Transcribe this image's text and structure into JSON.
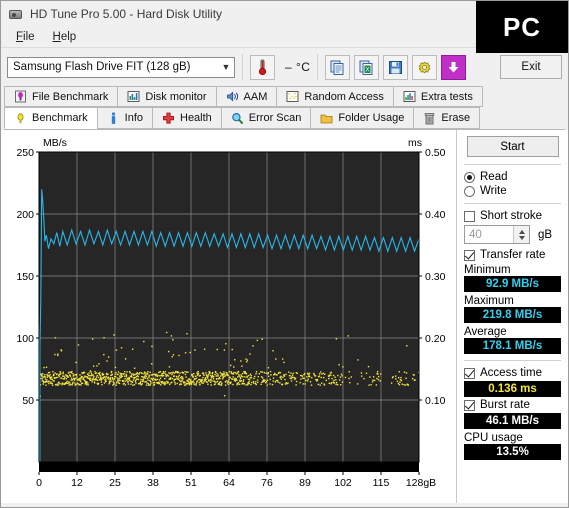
{
  "window": {
    "title": "HD Tune Pro 5.00 - Hard Disk Utility",
    "icon": "harddisk-icon"
  },
  "menu": {
    "items": [
      {
        "label": "File",
        "mnemonic": "F"
      },
      {
        "label": "Help",
        "mnemonic": "H"
      }
    ]
  },
  "toolbar": {
    "drive": {
      "value": "Samsung Flash Drive FIT  (128 gB)",
      "chevron": "chevron-down-icon"
    },
    "temperature": {
      "icon": "thermometer-icon",
      "value": "–  °C"
    },
    "buttons": [
      {
        "name": "copy-to-clipboard-button",
        "icon": "copy-icon"
      },
      {
        "name": "copy-to-excel-button",
        "icon": "excel-copy-icon"
      },
      {
        "name": "save-button",
        "icon": "floppy-save-icon"
      },
      {
        "name": "options-button",
        "icon": "gear-icon"
      },
      {
        "name": "download-button",
        "icon": "download-arrow-icon"
      }
    ],
    "exit_label": "Exit"
  },
  "overlay": {
    "watermark": "PC"
  },
  "tabs": {
    "row1": [
      {
        "label": "File Benchmark",
        "icon": "file-benchmark-icon",
        "selected": false
      },
      {
        "label": "Disk monitor",
        "icon": "disk-monitor-icon",
        "selected": false
      },
      {
        "label": "AAM",
        "icon": "speaker-icon",
        "selected": false
      },
      {
        "label": "Random Access",
        "icon": "random-access-icon",
        "selected": false
      },
      {
        "label": "Extra tests",
        "icon": "extra-tests-icon",
        "selected": false
      }
    ],
    "row2": [
      {
        "label": "Benchmark",
        "icon": "benchmark-icon",
        "selected": true
      },
      {
        "label": "Info",
        "icon": "info-icon",
        "selected": false
      },
      {
        "label": "Health",
        "icon": "health-cross-icon",
        "selected": false
      },
      {
        "label": "Error Scan",
        "icon": "magnifier-icon",
        "selected": false
      },
      {
        "label": "Folder Usage",
        "icon": "folder-icon",
        "selected": false
      },
      {
        "label": "Erase",
        "icon": "trash-icon",
        "selected": false
      }
    ]
  },
  "panel": {
    "start_label": "Start",
    "mode": {
      "read_label": "Read",
      "write_label": "Write",
      "selected": "Read"
    },
    "short_stroke": {
      "label": "Short stroke",
      "checked": false,
      "value": "40",
      "unit": "gB"
    },
    "transfer_rate": {
      "label": "Transfer rate",
      "checked": true
    },
    "minimum": {
      "label": "Minimum",
      "value": "92.9 MB/s"
    },
    "maximum": {
      "label": "Maximum",
      "value": "219.8 MB/s"
    },
    "average": {
      "label": "Average",
      "value": "178.1 MB/s"
    },
    "access_time": {
      "label": "Access time",
      "checked": true,
      "value": "0.136 ms"
    },
    "burst_rate": {
      "label": "Burst rate",
      "checked": true,
      "value": "46.1 MB/s"
    },
    "cpu_usage": {
      "label": "CPU usage",
      "value": "13.5%"
    }
  },
  "chart_data": {
    "type": "line",
    "title": "",
    "ylabel": "MB/s",
    "ylabel_right": "ms",
    "xlabel": "",
    "ylim": [
      0,
      250
    ],
    "ylim_right": [
      0,
      0.5
    ],
    "xlim": [
      0,
      128
    ],
    "yticks": [
      250,
      200,
      150,
      100,
      50
    ],
    "yticks_right": [
      0.5,
      0.4,
      0.3,
      0.2,
      0.1
    ],
    "xticks": [
      "0",
      "12",
      "25",
      "38",
      "51",
      "64",
      "76",
      "89",
      "102",
      "115",
      "128gB"
    ],
    "grid": true,
    "background": "#262626",
    "series": [
      {
        "name": "Transfer rate",
        "color": "#29b6e8",
        "axis": "left",
        "units": "MB/s",
        "x": [
          0.3,
          0.6,
          0.9,
          1.2,
          1.6,
          2.0,
          2.5,
          3.2,
          4.0,
          5.0,
          6.0,
          7.0,
          8.0,
          9.5,
          11,
          12.5,
          14,
          15.5,
          17,
          18.5,
          20,
          21.5,
          23,
          24.5,
          26,
          27.5,
          29,
          30.5,
          32,
          33.5,
          35,
          36.5,
          38,
          39.5,
          41,
          42.5,
          44,
          45.5,
          47,
          48.5,
          50,
          51.5,
          53,
          54.5,
          56,
          57.5,
          59,
          60.5,
          62,
          63.5,
          65,
          66.5,
          68,
          69.5,
          71,
          72.5,
          74,
          75.5,
          77,
          78.5,
          80,
          81.5,
          83,
          84.5,
          86,
          87.5,
          89,
          90.5,
          92,
          93.5,
          95,
          96.5,
          98,
          99.5,
          101,
          102.5,
          104,
          105.5,
          107,
          108.5,
          110,
          111.5,
          113,
          114.5,
          116,
          117.5,
          119,
          120.5,
          122,
          123.5,
          125,
          126.5,
          128
        ],
        "y": [
          92.9,
          130,
          219.8,
          212,
          196,
          178,
          183,
          172,
          180,
          176,
          185,
          174,
          186,
          175,
          187,
          176,
          186,
          175,
          187,
          176,
          186,
          175,
          187,
          176,
          186,
          175,
          186,
          175,
          186,
          175,
          186,
          175,
          186,
          174,
          185,
          174,
          185,
          174,
          185,
          174,
          185,
          174,
          185,
          174,
          185,
          174,
          184,
          174,
          184,
          173,
          184,
          173,
          184,
          173,
          184,
          173,
          184,
          173,
          183,
          172,
          183,
          172,
          183,
          172,
          183,
          172,
          183,
          172,
          183,
          172,
          182,
          171,
          182,
          171,
          182,
          171,
          182,
          171,
          182,
          171,
          182,
          171,
          181,
          170,
          181,
          170,
          181,
          170,
          181,
          170,
          181,
          170,
          180
        ],
        "min": 92.9,
        "max": 219.8,
        "avg": 178.1,
        "note": "initial spike to 219.8 then regular sawtooth oscillation ~170-187 MB/s"
      },
      {
        "name": "Access time",
        "color": "#f5e63c",
        "axis": "right",
        "units": "ms",
        "style": "scatter",
        "mean": 0.136,
        "spread": [
          0.1,
          0.22
        ],
        "note": "dense yellow dot band near 0.13 ms across full span, thinning toward the right"
      }
    ]
  }
}
